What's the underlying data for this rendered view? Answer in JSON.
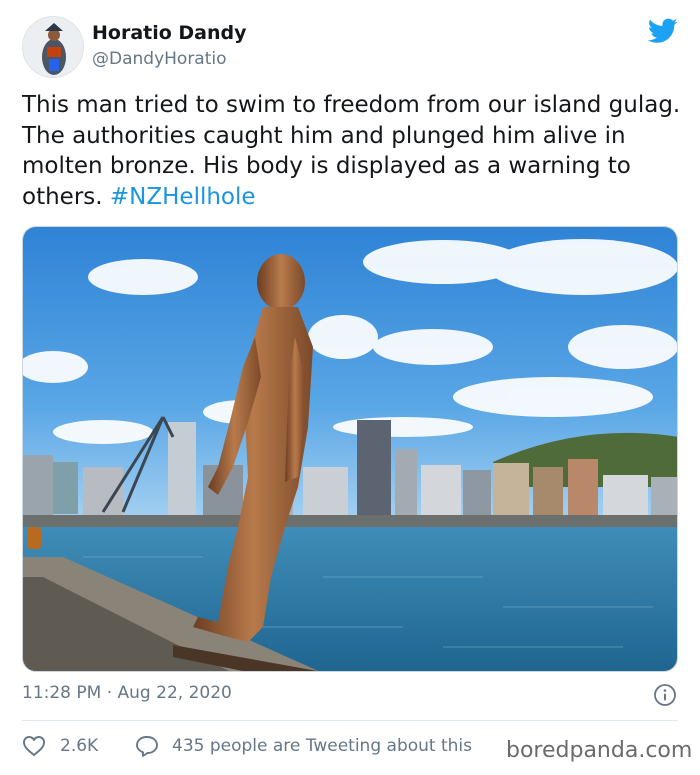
{
  "tweet": {
    "display_name": "Horatio Dandy",
    "handle": "@DandyHoratio",
    "text_main": "This man tried to swim to freedom from our island gulag. The authorities caught him and plunged him alive in molten bronze. His body is displayed as a warning to others. ",
    "hashtag": "#NZHellhole",
    "timestamp": "11:28 PM · Aug 22, 2020",
    "likes": "2.6K",
    "tweeting": "435 people are Tweeting about this"
  },
  "icons": {
    "brand": "twitter-bird-icon",
    "info": "info-icon",
    "like": "heart-icon",
    "reply": "speech-bubble-icon"
  },
  "colors": {
    "accent": "#1da1f2",
    "hashtag": "#1b95e0",
    "muted": "#657786"
  },
  "watermark": "boredpanda.com"
}
